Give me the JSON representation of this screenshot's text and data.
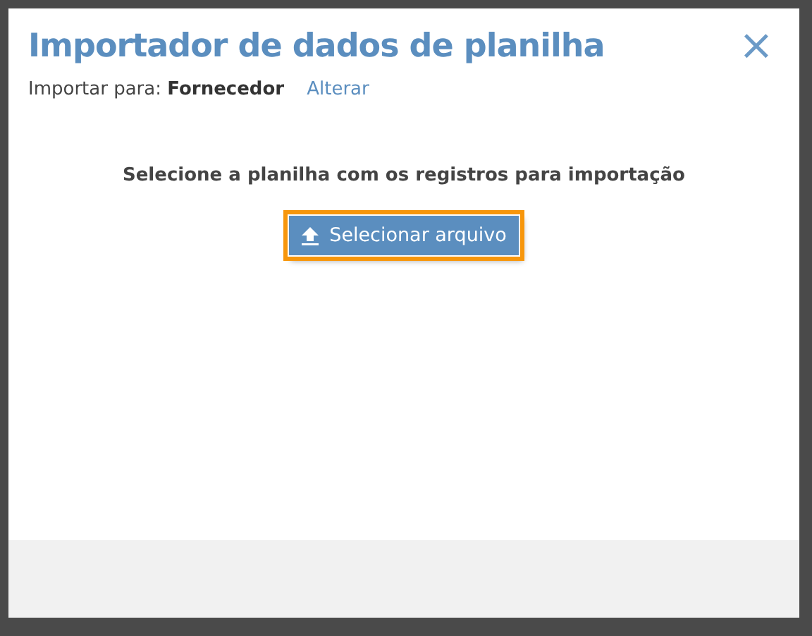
{
  "dialog": {
    "title": "Importador de dados de planilha",
    "close": "×",
    "target": "Importar para: **Fornecedor**",
    "change_link": "Alterar"
  },
  "body": {
    "instruction": "Selecione a planilha com os registros para importação",
    "button": {
      "label": "Selecionar arquivo",
      "focused": true
    }
  }
}
